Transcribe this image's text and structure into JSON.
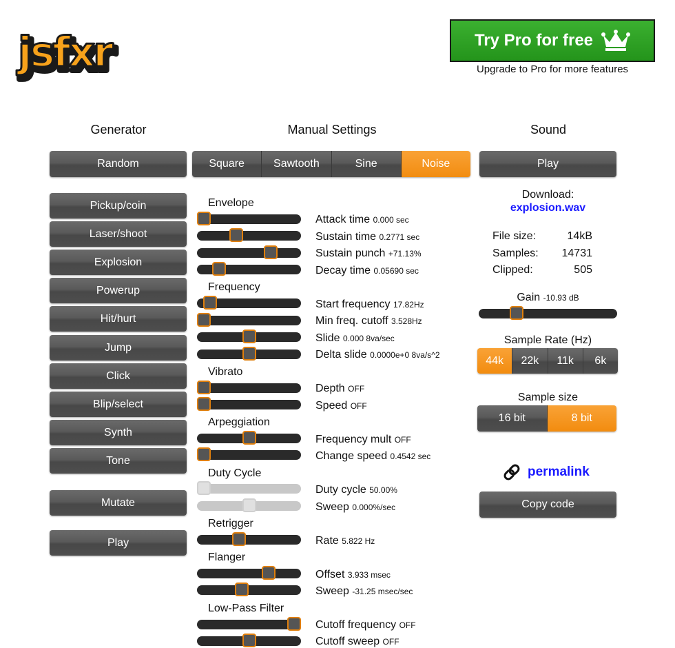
{
  "header": {
    "logo_text": "jsfxr",
    "pro_button": "Try Pro for free",
    "pro_subtitle": "Upgrade to Pro for more features"
  },
  "columns": {
    "generator": "Generator",
    "manual": "Manual Settings",
    "sound": "Sound"
  },
  "generator": {
    "random": "Random",
    "presets": [
      "Pickup/coin",
      "Laser/shoot",
      "Explosion",
      "Powerup",
      "Hit/hurt",
      "Jump",
      "Click",
      "Blip/select",
      "Synth",
      "Tone"
    ],
    "mutate": "Mutate",
    "play": "Play"
  },
  "waveforms": {
    "options": [
      "Square",
      "Sawtooth",
      "Sine",
      "Noise"
    ],
    "selected": "Noise"
  },
  "sections": {
    "envelope": "Envelope",
    "frequency": "Frequency",
    "vibrato": "Vibrato",
    "arpeggiation": "Arpeggiation",
    "duty": "Duty Cycle",
    "retrigger": "Retrigger",
    "flanger": "Flanger",
    "lpf": "Low-Pass Filter"
  },
  "params": [
    {
      "label": "Attack time",
      "value": "0.000 sec",
      "level": 0.0,
      "disabled": false
    },
    {
      "label": "Sustain time",
      "value": "0.2771 sec",
      "level": 0.36,
      "disabled": false
    },
    {
      "label": "Sustain punch",
      "value": "+71.13%",
      "level": 0.74,
      "disabled": false
    },
    {
      "label": "Decay time",
      "value": "0.05690 sec",
      "level": 0.17,
      "disabled": false
    },
    {
      "label": "Start frequency",
      "value": "17.82Hz",
      "level": 0.07,
      "disabled": false
    },
    {
      "label": "Min freq. cutoff",
      "value": "3.528Hz",
      "level": 0.0,
      "disabled": false
    },
    {
      "label": "Slide",
      "value": "0.000 8va/sec",
      "level": 0.5,
      "disabled": false
    },
    {
      "label": "Delta slide",
      "value": "0.0000e+0 8va/s^2",
      "level": 0.5,
      "disabled": false
    },
    {
      "label": "Depth",
      "value": "OFF",
      "level": 0.0,
      "disabled": false
    },
    {
      "label": "Speed",
      "value": "OFF",
      "level": 0.0,
      "disabled": false
    },
    {
      "label": "Frequency mult",
      "value": "OFF",
      "level": 0.5,
      "disabled": false
    },
    {
      "label": "Change speed",
      "value": "0.4542 sec",
      "level": 0.0,
      "disabled": false
    },
    {
      "label": "Duty cycle",
      "value": "50.00%",
      "level": 0.0,
      "disabled": true
    },
    {
      "label": "Sweep",
      "value": "0.000%/sec",
      "level": 0.5,
      "disabled": true
    },
    {
      "label": "Rate",
      "value": "5.822 Hz",
      "level": 0.39,
      "disabled": false
    },
    {
      "label": "Offset",
      "value": "3.933 msec",
      "level": 0.72,
      "disabled": false
    },
    {
      "label": "Sweep",
      "value": "-31.25 msec/sec",
      "level": 0.42,
      "disabled": false
    },
    {
      "label": "Cutoff frequency",
      "value": "OFF",
      "level": 1.0,
      "disabled": false
    },
    {
      "label": "Cutoff sweep",
      "value": "OFF",
      "level": 0.5,
      "disabled": false
    }
  ],
  "sound": {
    "play": "Play",
    "download_label": "Download:",
    "download_file": "explosion.wav",
    "file_size_label": "File size:",
    "file_size": "14kB",
    "samples_label": "Samples:",
    "samples": "14731",
    "clipped_label": "Clipped:",
    "clipped": "505",
    "gain_label": "Gain",
    "gain_value": "-10.93 dB",
    "gain_level": 0.25,
    "sample_rate_label": "Sample Rate (Hz)",
    "sample_rates": [
      "44k",
      "22k",
      "11k",
      "6k"
    ],
    "sample_rate_selected": "44k",
    "sample_size_label": "Sample size",
    "sample_sizes": [
      "16 bit",
      "8 bit"
    ],
    "sample_size_selected": "8 bit",
    "permalink": "permalink",
    "copy_code": "Copy code"
  },
  "colors": {
    "accent": "#f28c0f",
    "pro_green": "#2aa022",
    "link": "#1a1aff",
    "button": "#555555"
  }
}
